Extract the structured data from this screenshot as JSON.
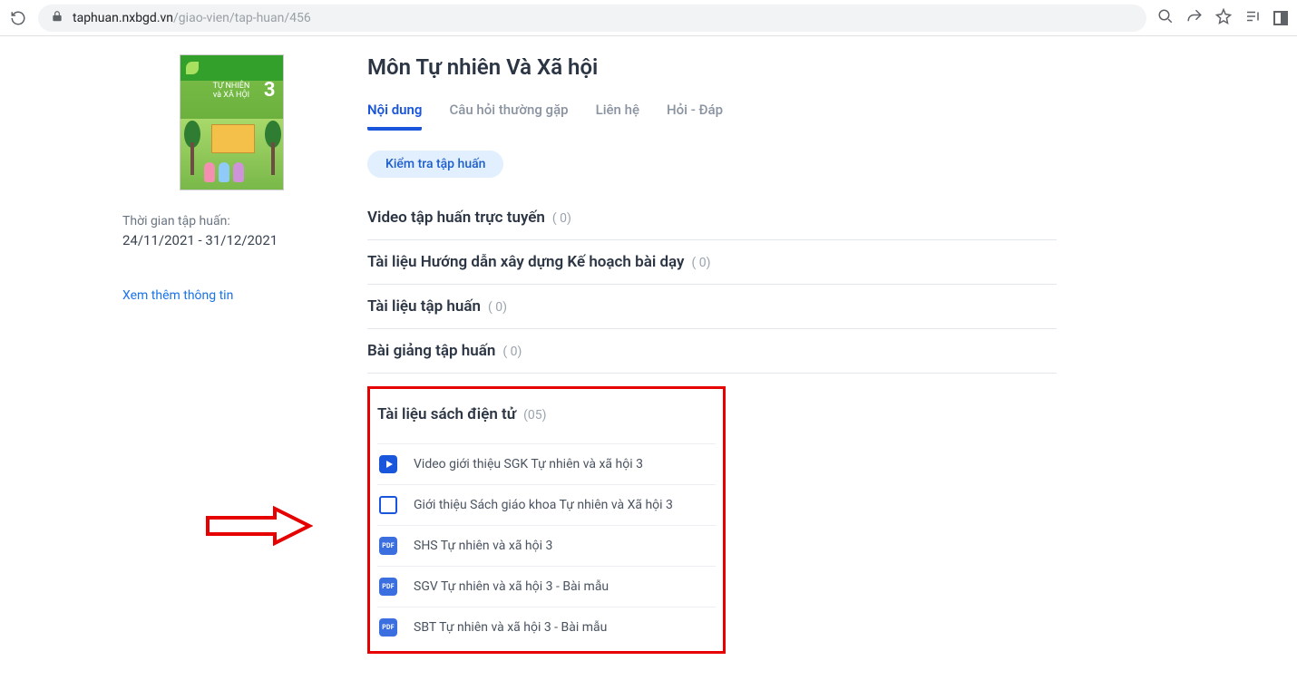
{
  "browser": {
    "url_host": "taphuan.nxbgd.vn",
    "url_path": "/giao-vien/tap-huan/456"
  },
  "sidebar": {
    "book_title_line1": "TỰ NHIÊN",
    "book_title_line2": "và XÃ HỘI",
    "book_grade": "3",
    "time_label": "Thời gian tập huấn:",
    "time_value": "24/11/2021 - 31/12/2021",
    "more_link": "Xem thêm thông tin"
  },
  "main": {
    "title": "Môn Tự nhiên Và Xã hội",
    "tabs": {
      "content": "Nội dung",
      "faq": "Câu hỏi thường gặp",
      "contact": "Liên hệ",
      "qa": "Hỏi - Đáp"
    },
    "chip": "Kiểm tra tập huấn",
    "sections": {
      "video": {
        "title": "Video tập huấn trực tuyến",
        "count": "( 0)"
      },
      "guide": {
        "title": "Tài liệu Hướng dẫn xây dựng Kế hoạch bài dạy",
        "count": "( 0)"
      },
      "docs": {
        "title": "Tài liệu tập huấn",
        "count": "( 0)"
      },
      "lecture": {
        "title": "Bài giảng tập huấn",
        "count": "( 0)"
      },
      "ebook": {
        "title": "Tài liệu sách điện tử",
        "count": "(05)"
      }
    },
    "resources": [
      {
        "icon": "play",
        "label": "Video giới thiệu SGK Tự nhiên và xã hội 3"
      },
      {
        "icon": "slide",
        "label": "Giới thiệu Sách giáo khoa Tự nhiên và Xã hội 3"
      },
      {
        "icon": "pdf",
        "label": "SHS Tự nhiên và xã hội 3"
      },
      {
        "icon": "pdf",
        "label": "SGV Tự nhiên và xã hội 3 - Bài mẫu"
      },
      {
        "icon": "pdf",
        "label": "SBT Tự nhiên và xã hội 3 - Bài mẫu"
      }
    ],
    "pdf_badge": "PDF"
  }
}
